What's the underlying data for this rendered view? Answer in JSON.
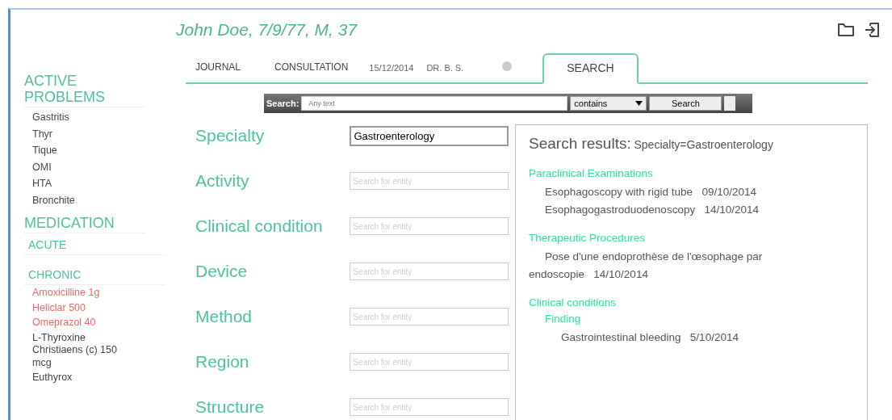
{
  "patient": {
    "title": "John Doe, 7/9/77, M, 37"
  },
  "sidebar": {
    "active_problems": {
      "heading": "ACTIVE PROBLEMS",
      "items": [
        "Gastritis",
        "Thyr",
        "Tique",
        "OMI",
        "HTA",
        "Bronchite"
      ]
    },
    "medication": {
      "heading": "MEDICATION",
      "sections": [
        {
          "label": "ACUTE"
        },
        {
          "label": "CHRONIC",
          "items": [
            {
              "name": "Amoxicilline 1g",
              "color": "#e46a6a"
            },
            {
              "name": "Heliclar 500",
              "color": "#e46a6a"
            },
            {
              "name": "Omeprazol 40",
              "color": "#e46a6a"
            },
            {
              "name": "L-Thyroxine Christiaens (c) 150 mcg",
              "color": "#444444"
            },
            {
              "name": "Euthyrox",
              "color": "#444444"
            }
          ]
        }
      ]
    }
  },
  "tabs": [
    {
      "label": "JOURNAL",
      "selected": false
    },
    {
      "label": "CONSULTATION",
      "date": "15/12/2014",
      "doctor": "DR. B. S.",
      "closable": true,
      "selected": false
    },
    {
      "label": "SEARCH",
      "selected": true
    }
  ],
  "search_bar": {
    "label": "Search:",
    "placeholder": "Any text",
    "operator": "contains",
    "button": "Search"
  },
  "form": [
    {
      "label": "Specialty",
      "value": "Gastroenterology"
    },
    {
      "label": "Activity",
      "placeholder": "Search for entity"
    },
    {
      "label": "Clinical condition",
      "placeholder": "Search for entity"
    },
    {
      "label": "Device",
      "placeholder": "Search for entity"
    },
    {
      "label": "Method",
      "placeholder": "Search for entity"
    },
    {
      "label": "Region",
      "placeholder": "Search for entity"
    },
    {
      "label": "Structure",
      "placeholder": "Search for entity"
    }
  ],
  "results": {
    "title": "Search results:",
    "query": "Specialty=Gastroenterology",
    "groups": [
      {
        "heading": "Paraclinical Examinations",
        "items": [
          {
            "text": "Esophagoscopy with rigid tube",
            "date": "09/10/2014"
          },
          {
            "text": "Esophagogastroduodenoscopy",
            "date": "14/10/2014"
          }
        ]
      },
      {
        "heading": "Therapeutic Procedures",
        "items": [
          {
            "text": "Pose d'une endoprothèse de l'œsophage par endoscopie",
            "date": "14/10/2014"
          }
        ]
      },
      {
        "heading": "Clinical conditions",
        "children": [
          {
            "heading": "Finding",
            "items": [
              {
                "text": "Gastrointestinal bleeding",
                "date": "5/10/2014"
              }
            ]
          }
        ]
      }
    ]
  }
}
